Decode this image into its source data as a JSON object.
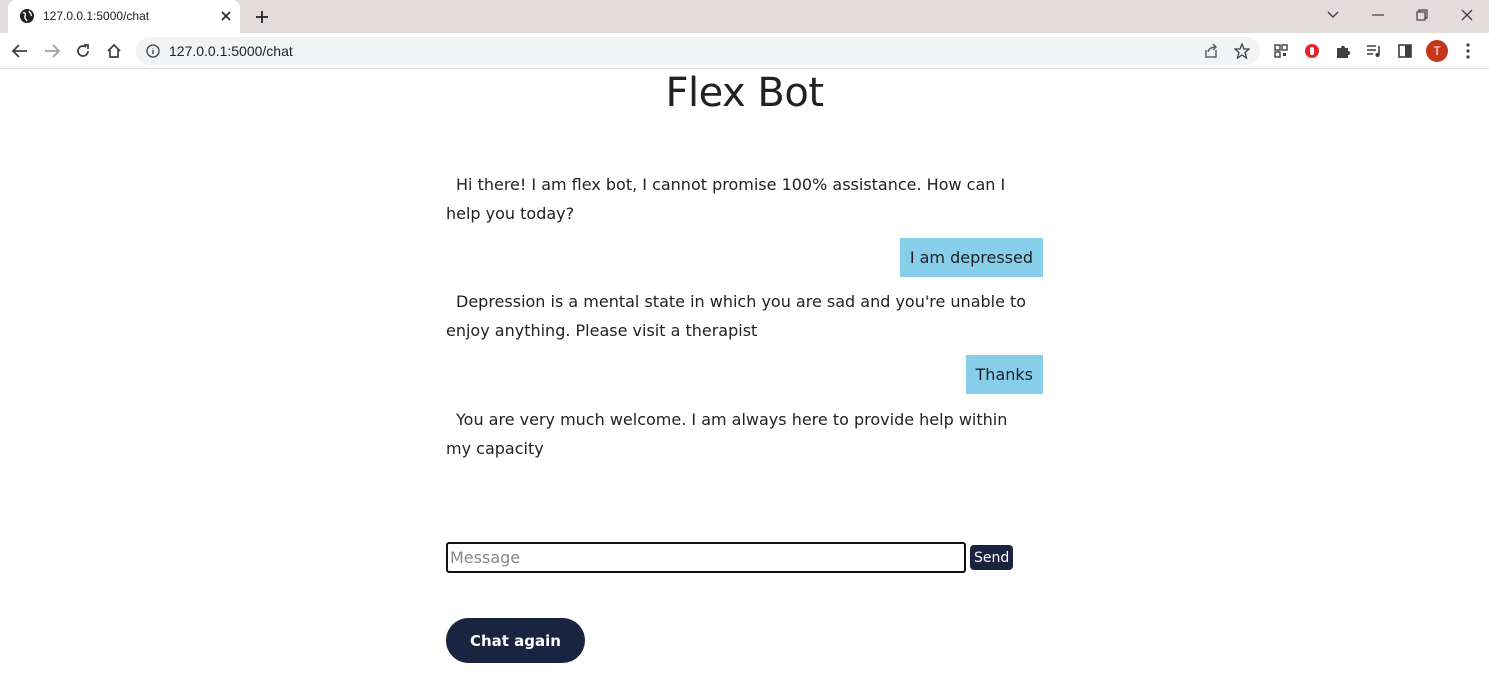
{
  "browser": {
    "tab_title": "127.0.0.1:5000/chat",
    "url": "127.0.0.1:5000/chat",
    "profile_initial": "T"
  },
  "page": {
    "title": "Flex Bot"
  },
  "chat": {
    "messages": [
      {
        "sender": "bot",
        "text": "Hi there! I am flex bot, I cannot promise 100% assistance. How can I help you today?"
      },
      {
        "sender": "user",
        "text": "I am depressed"
      },
      {
        "sender": "bot",
        "text": "Depression is a mental state in which you are sad and you're unable to enjoy anything. Please visit a therapist"
      },
      {
        "sender": "user",
        "text": "Thanks"
      },
      {
        "sender": "bot",
        "text": "You are very much welcome. I am always here to provide help within my capacity"
      }
    ]
  },
  "composer": {
    "placeholder": "Message",
    "value": "",
    "send_label": "Send"
  },
  "actions": {
    "chat_again_label": "Chat again"
  },
  "colors": {
    "user_bubble": "#87ceeb",
    "button_bg": "#1a2340",
    "profile_avatar": "#c5371b"
  }
}
